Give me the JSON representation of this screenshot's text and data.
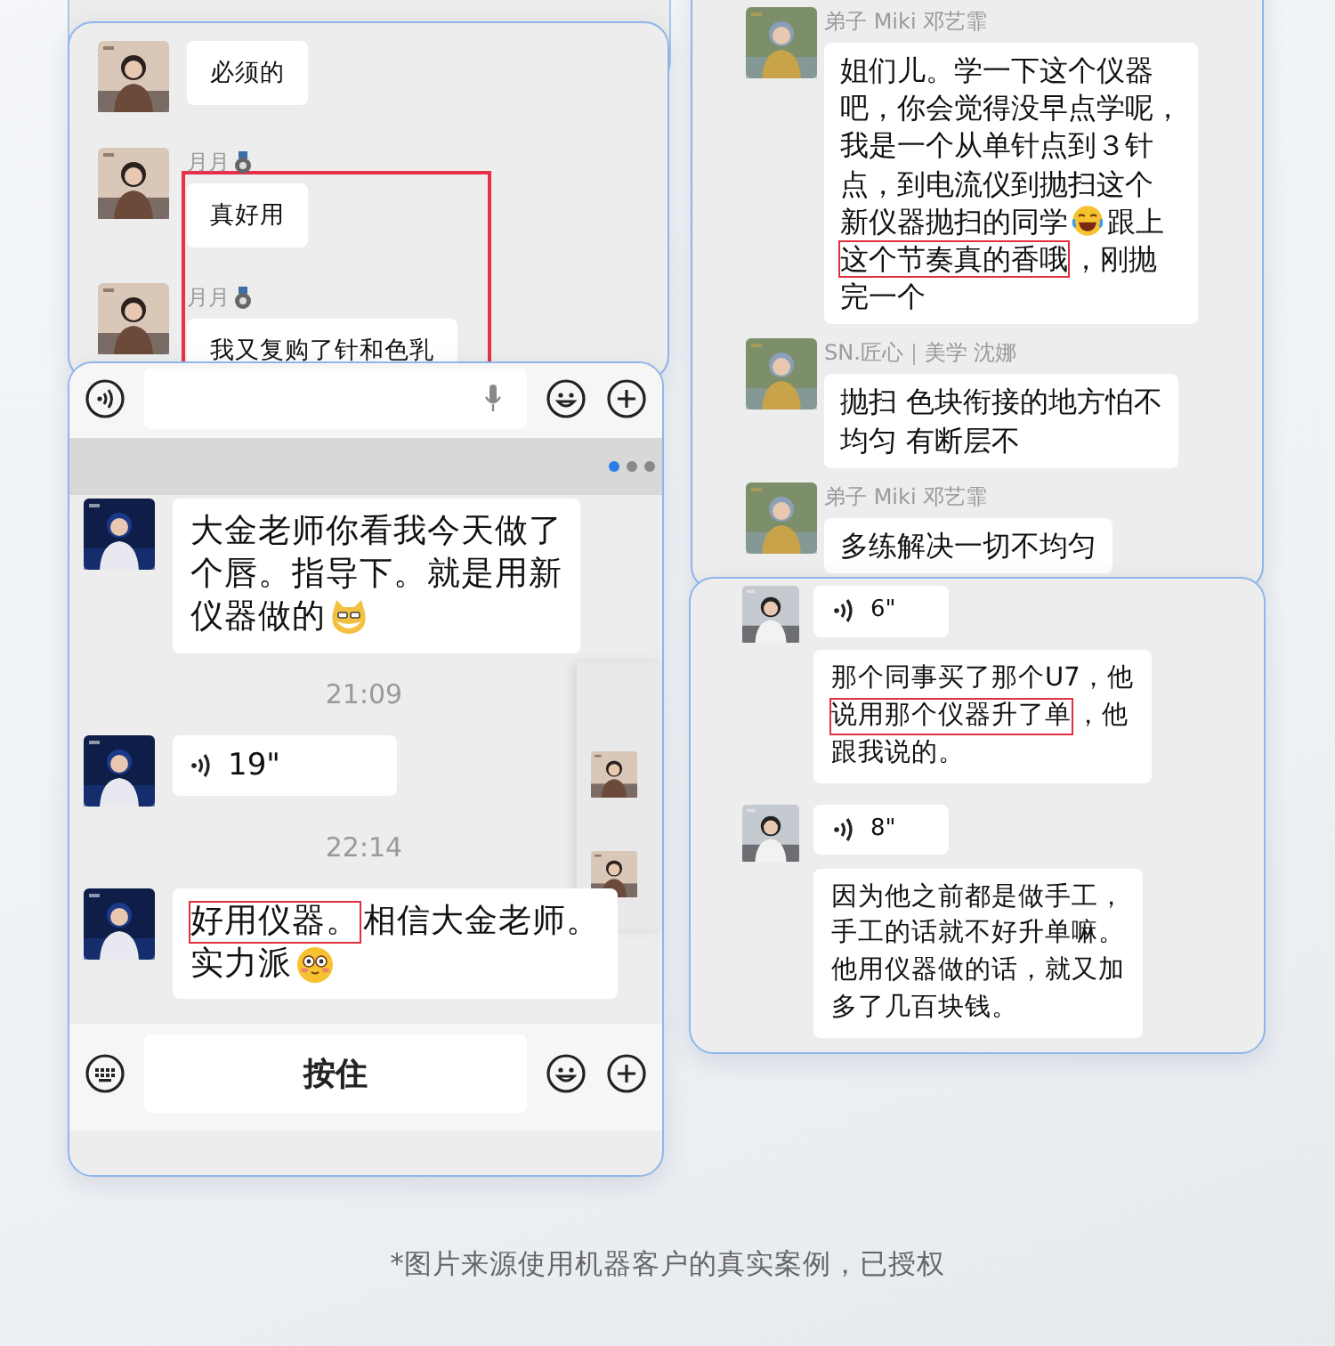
{
  "cards": [
    {
      "kind": "chat",
      "highlight_frame": true,
      "sections": [
        {
          "kind": "messages",
          "messages": [
            {
              "kind": "text",
              "avatar": true,
              "lines": [
                [
                  {
                    "kind": "text",
                    "text": "必须的",
                    "highlighted": false
                  }
                ]
              ]
            },
            {
              "kind": "text",
              "avatar": true,
              "sender": "月月",
              "badge": true,
              "lines": [
                [
                  {
                    "kind": "text",
                    "text": "真好用",
                    "highlighted": false
                  }
                ]
              ]
            },
            {
              "kind": "text",
              "avatar": true,
              "sender": "月月",
              "badge": true,
              "lines": [
                [
                  {
                    "kind": "text",
                    "text": "我又复购了针和色乳",
                    "highlighted": false
                  }
                ]
              ]
            }
          ]
        }
      ]
    },
    {
      "kind": "chat",
      "sections": [
        {
          "kind": "inputbar",
          "items": [
            {
              "kind": "voice"
            },
            {
              "kind": "field"
            },
            {
              "kind": "emoji"
            },
            {
              "kind": "plus"
            }
          ]
        },
        {
          "kind": "pager",
          "dots": [
            {
              "selected": true
            },
            {
              "selected": false
            },
            {
              "selected": false
            }
          ]
        },
        {
          "kind": "messages",
          "messages": [
            {
              "kind": "text",
              "avatar": true,
              "lines": [
                [
                  {
                    "kind": "text",
                    "text": "大金老师你看我今天做了",
                    "highlighted": false
                  }
                ],
                [
                  {
                    "kind": "text",
                    "text": "个唇。指导下。就是用新",
                    "highlighted": false
                  }
                ],
                [
                  {
                    "kind": "text",
                    "text": "仪器做的",
                    "highlighted": false
                  },
                  {
                    "kind": "cat"
                  }
                ]
              ]
            },
            {
              "kind": "time",
              "text": "21:09"
            },
            {
              "kind": "voice",
              "avatar": true,
              "duration": "19\""
            },
            {
              "kind": "time",
              "text": "22:14"
            },
            {
              "kind": "text",
              "avatar": true,
              "lines": [
                [
                  {
                    "kind": "text",
                    "text": "好用仪器。",
                    "highlighted": true
                  },
                  {
                    "kind": "text",
                    "text": "相信大金老师。",
                    "highlighted": false
                  }
                ],
                [
                  {
                    "kind": "text",
                    "text": "实力派",
                    "highlighted": false
                  },
                  {
                    "kind": "blush"
                  }
                ]
              ]
            }
          ]
        },
        {
          "kind": "inputbar",
          "items": [
            {
              "kind": "keyboard"
            },
            {
              "kind": "talk",
              "label": "按住"
            },
            {
              "kind": "emoji"
            },
            {
              "kind": "plus"
            }
          ]
        }
      ]
    },
    {
      "kind": "chat",
      "sections": [
        {
          "kind": "messages",
          "messages": [
            {
              "kind": "text",
              "avatar": true,
              "sender": "弟子 Miki 邓艺霏",
              "lines": [
                [
                  {
                    "kind": "text",
                    "text": "姐们儿。学一下这个仪器",
                    "highlighted": false
                  }
                ],
                [
                  {
                    "kind": "text",
                    "text": "吧，你会觉得没早点学呢，",
                    "highlighted": false
                  }
                ],
                [
                  {
                    "kind": "text",
                    "text": "我是一个从单针点到３针",
                    "highlighted": false
                  }
                ],
                [
                  {
                    "kind": "text",
                    "text": "点，到电流仪到抛扫这个",
                    "highlighted": false
                  }
                ],
                [
                  {
                    "kind": "text",
                    "text": "新仪器抛扫的同学",
                    "highlighted": false
                  },
                  {
                    "kind": "laugh"
                  },
                  {
                    "kind": "text",
                    "text": "跟上",
                    "highlighted": false
                  }
                ],
                [
                  {
                    "kind": "text",
                    "text": "这个节奏真的香哦",
                    "highlighted": true
                  },
                  {
                    "kind": "text",
                    "text": "，刚抛",
                    "highlighted": false
                  }
                ],
                [
                  {
                    "kind": "text",
                    "text": "完一个",
                    "highlighted": false
                  }
                ]
              ]
            },
            {
              "kind": "text",
              "avatar": true,
              "sender": "SN.匠心｜美学 沈娜",
              "lines": [
                [
                  {
                    "kind": "text",
                    "text": "抛扫 色块衔接的地方怕不",
                    "highlighted": false
                  }
                ],
                [
                  {
                    "kind": "text",
                    "text": "均匀 有断层不",
                    "highlighted": false
                  }
                ]
              ]
            },
            {
              "kind": "text",
              "avatar": true,
              "sender": "弟子 Miki 邓艺霏",
              "lines": [
                [
                  {
                    "kind": "text",
                    "text": "多练解决一切不均匀",
                    "highlighted": false
                  }
                ]
              ]
            }
          ]
        }
      ]
    },
    {
      "kind": "chat",
      "sections": [
        {
          "kind": "messages",
          "messages": [
            {
              "kind": "voice",
              "avatar": true,
              "duration": "6\""
            },
            {
              "kind": "text",
              "avatar": false,
              "lines": [
                [
                  {
                    "kind": "text",
                    "text": "那个同事买了那个U7，他",
                    "highlighted": false
                  }
                ],
                [
                  {
                    "kind": "text",
                    "text": "说用那个仪器升了单",
                    "highlighted": true
                  },
                  {
                    "kind": "text",
                    "text": "，他",
                    "highlighted": false
                  }
                ],
                [
                  {
                    "kind": "text",
                    "text": "跟我说的。",
                    "highlighted": false
                  }
                ]
              ]
            },
            {
              "kind": "voice",
              "avatar": true,
              "duration": "8\""
            },
            {
              "kind": "text",
              "avatar": false,
              "lines": [
                [
                  {
                    "kind": "text",
                    "text": "因为他之前都是做手工，",
                    "highlighted": false
                  }
                ],
                [
                  {
                    "kind": "text",
                    "text": "手工的话就不好升单嘛。",
                    "highlighted": false
                  }
                ],
                [
                  {
                    "kind": "text",
                    "text": "他用仪器做的话，就又加",
                    "highlighted": false
                  }
                ],
                [
                  {
                    "kind": "text",
                    "text": "多了几百块钱。",
                    "highlighted": false
                  }
                ]
              ]
            }
          ]
        }
      ]
    }
  ],
  "footnote": "*图片来源使用机器客户的真实案例，已授权"
}
